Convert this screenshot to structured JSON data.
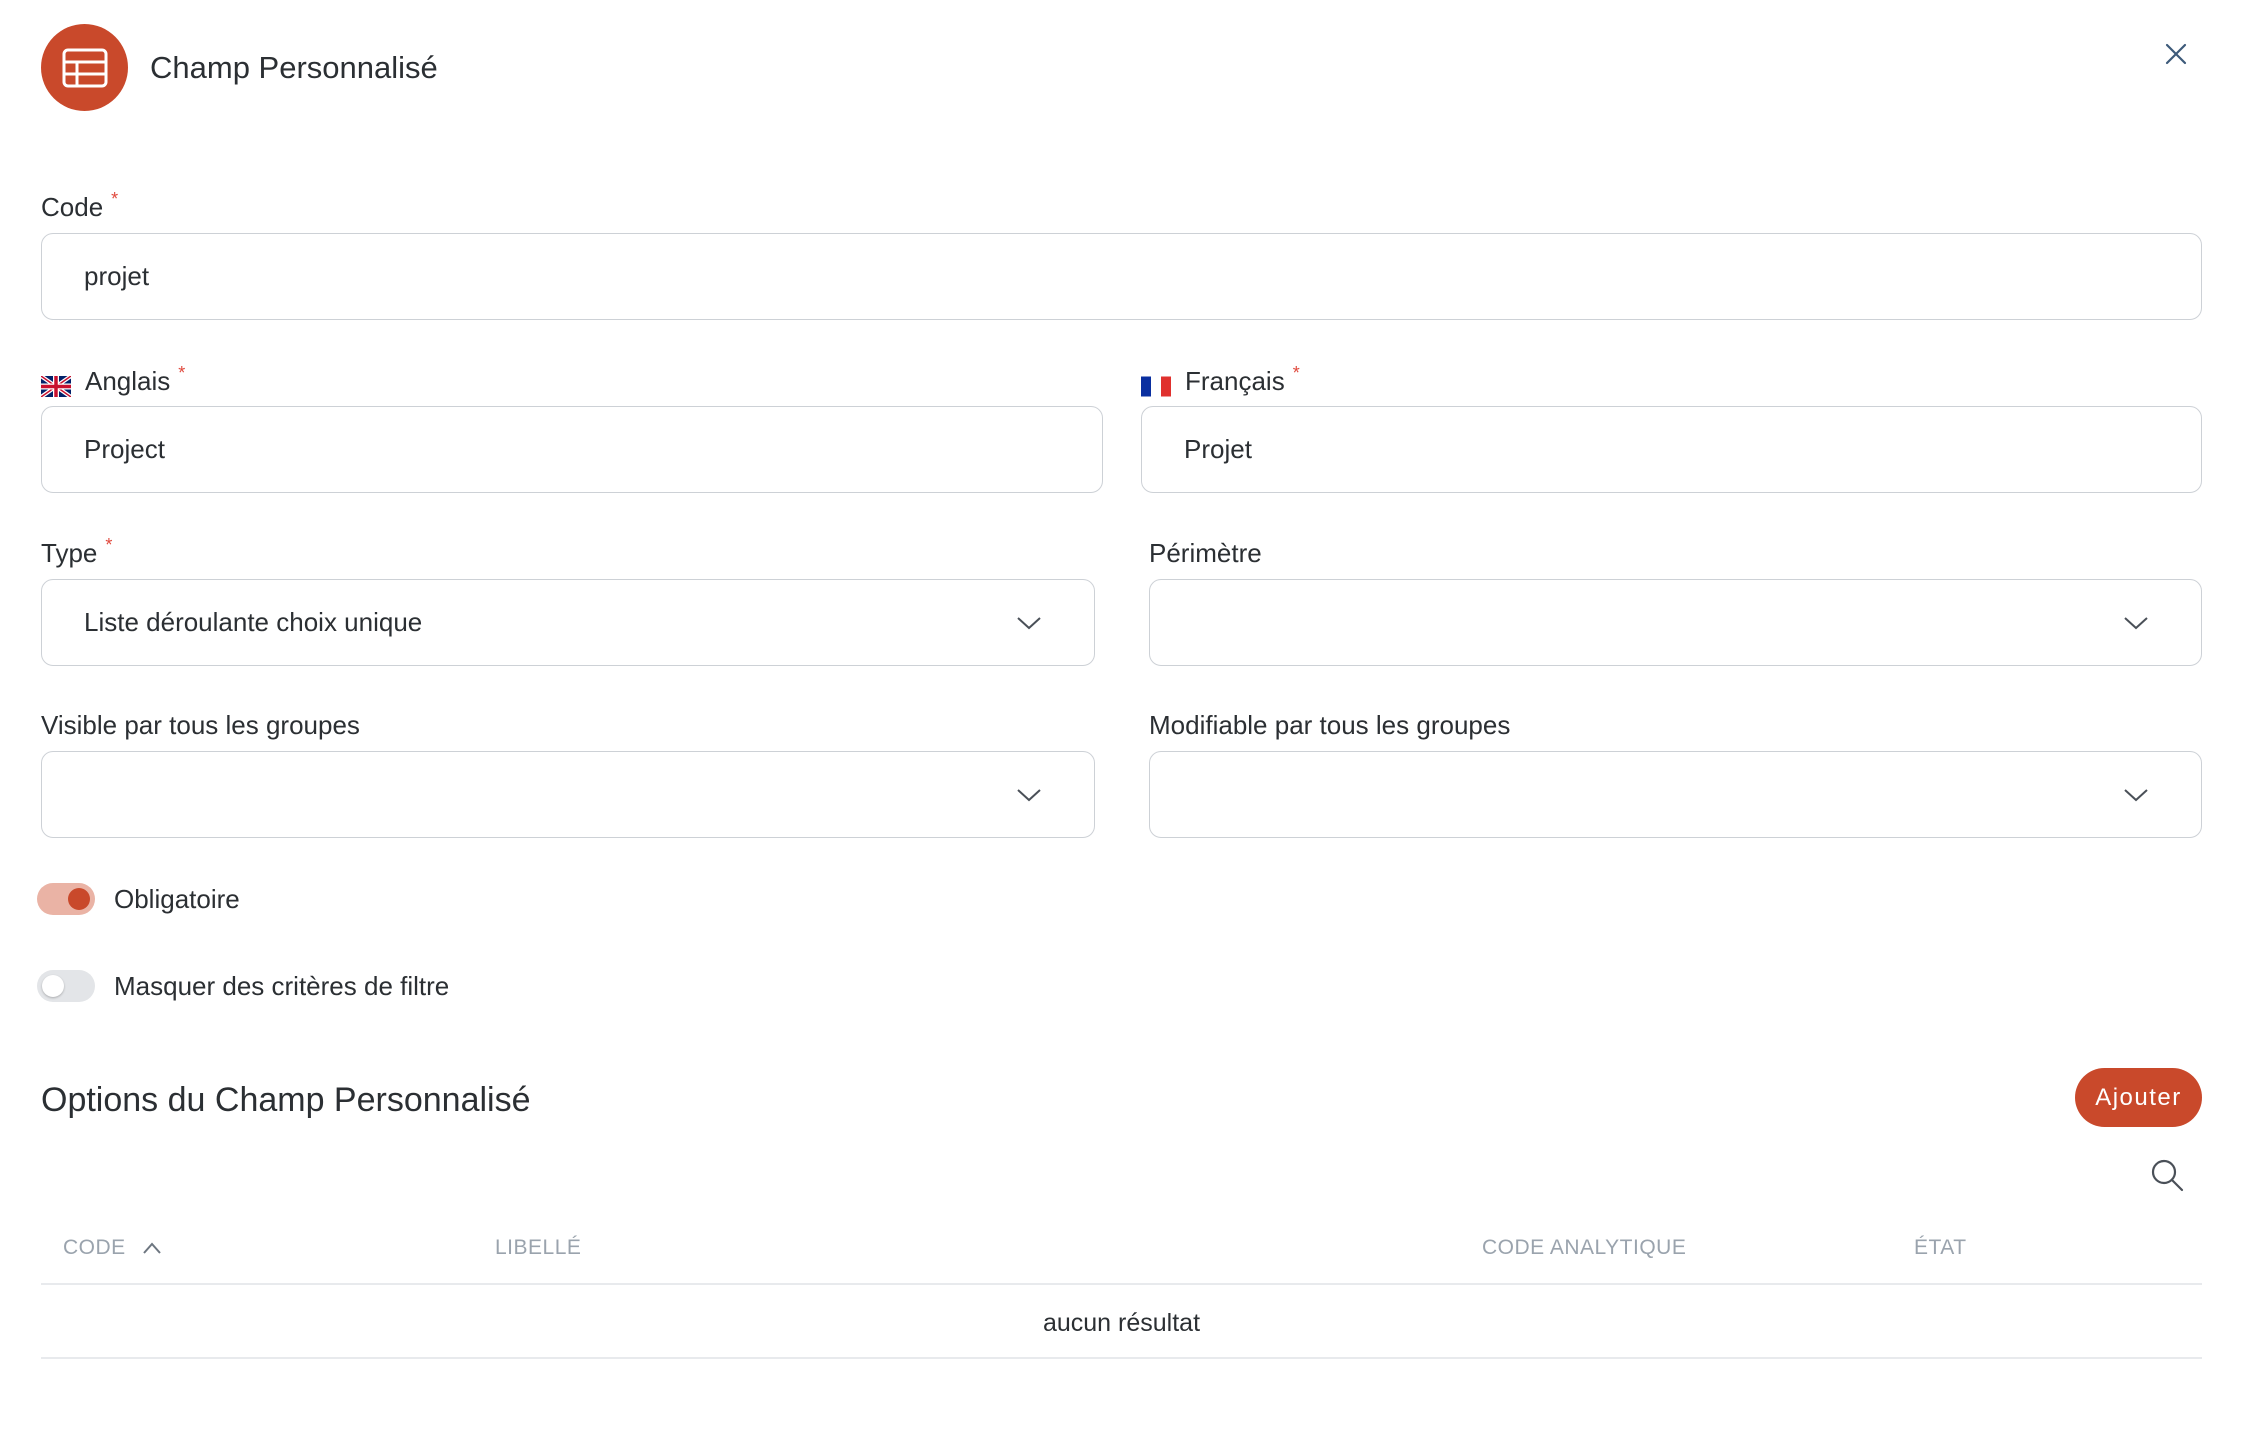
{
  "header": {
    "title": "Champ Personnalisé",
    "icon": "table-icon",
    "icon_color": "#c9492b"
  },
  "form": {
    "code": {
      "label": "Code",
      "required_mark": "*",
      "value": "projet"
    },
    "english": {
      "label": "Anglais",
      "required_mark": "*",
      "value": "Project",
      "flag": "uk-flag-icon"
    },
    "french": {
      "label": "Français",
      "required_mark": "*",
      "value": "Projet",
      "flag": "fr-flag-icon"
    },
    "type": {
      "label": "Type",
      "required_mark": "*",
      "value": "Liste déroulante choix unique"
    },
    "perimetre": {
      "label": "Périmètre",
      "value": ""
    },
    "visible": {
      "label": "Visible par tous les groupes",
      "value": ""
    },
    "modifiable": {
      "label": "Modifiable par tous les groupes",
      "value": ""
    },
    "obligatoire": {
      "label": "Obligatoire",
      "checked": true
    },
    "masquer": {
      "label": "Masquer des critères de filtre",
      "checked": false
    }
  },
  "options": {
    "title": "Options du Champ Personnalisé",
    "add_label": "Ajouter",
    "columns": [
      "CODE",
      "LIBELLÉ",
      "CODE ANALYTIQUE",
      "ÉTAT"
    ],
    "sort": {
      "column": "CODE",
      "direction": "ascending"
    },
    "empty_text": "aucun résultat"
  },
  "colors": {
    "accent": "#c9492b",
    "accent_light": "#eab3a5",
    "required": "#e0483c",
    "border": "#cdd1d6",
    "muted": "#9aa3ad"
  }
}
